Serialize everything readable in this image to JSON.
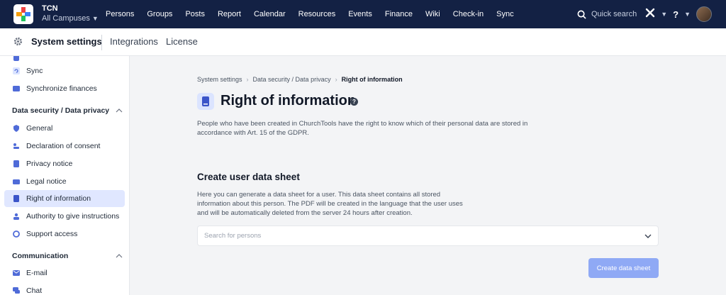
{
  "app": {
    "org_name": "TCN",
    "campus": "All Campuses"
  },
  "nav": [
    "Persons",
    "Groups",
    "Posts",
    "Report",
    "Calendar",
    "Resources",
    "Events",
    "Finance",
    "Wiki",
    "Check-in",
    "Sync"
  ],
  "topbar": {
    "quick_search": "Quick search",
    "help": "?"
  },
  "subheader": {
    "title": "System settings",
    "link_integrations": "Integrations",
    "link_license": "License"
  },
  "sidebar": {
    "items_top": [
      "Sync",
      "Synchronize finances"
    ],
    "group_privacy": "Data security / Data privacy",
    "privacy_items": [
      "General",
      "Declaration of consent",
      "Privacy notice",
      "Legal notice",
      "Right of information",
      "Authority to give instructions",
      "Support access"
    ],
    "group_communication": "Communication",
    "communication_items": [
      "E-mail",
      "Chat"
    ]
  },
  "breadcrumb": {
    "root": "System settings",
    "parent": "Data security / Data privacy",
    "current": "Right of information"
  },
  "page": {
    "title": "Right of information",
    "description": "People who have been created in ChurchTools have the right to know which of their personal data are stored in accordance with Art. 15 of the GDPR."
  },
  "section": {
    "title": "Create user data sheet",
    "description": "Here you can generate a data sheet for a user. This data sheet contains all stored information about this person. The PDF will be created in the language that the user uses and will be automatically deleted from the server 24 hours after creation.",
    "search_placeholder": "Search for persons",
    "button_label": "Create data sheet"
  },
  "colors": {
    "topbar": "#132144",
    "accent": "#8fa9f5",
    "active_item": "#e0e7ff"
  }
}
